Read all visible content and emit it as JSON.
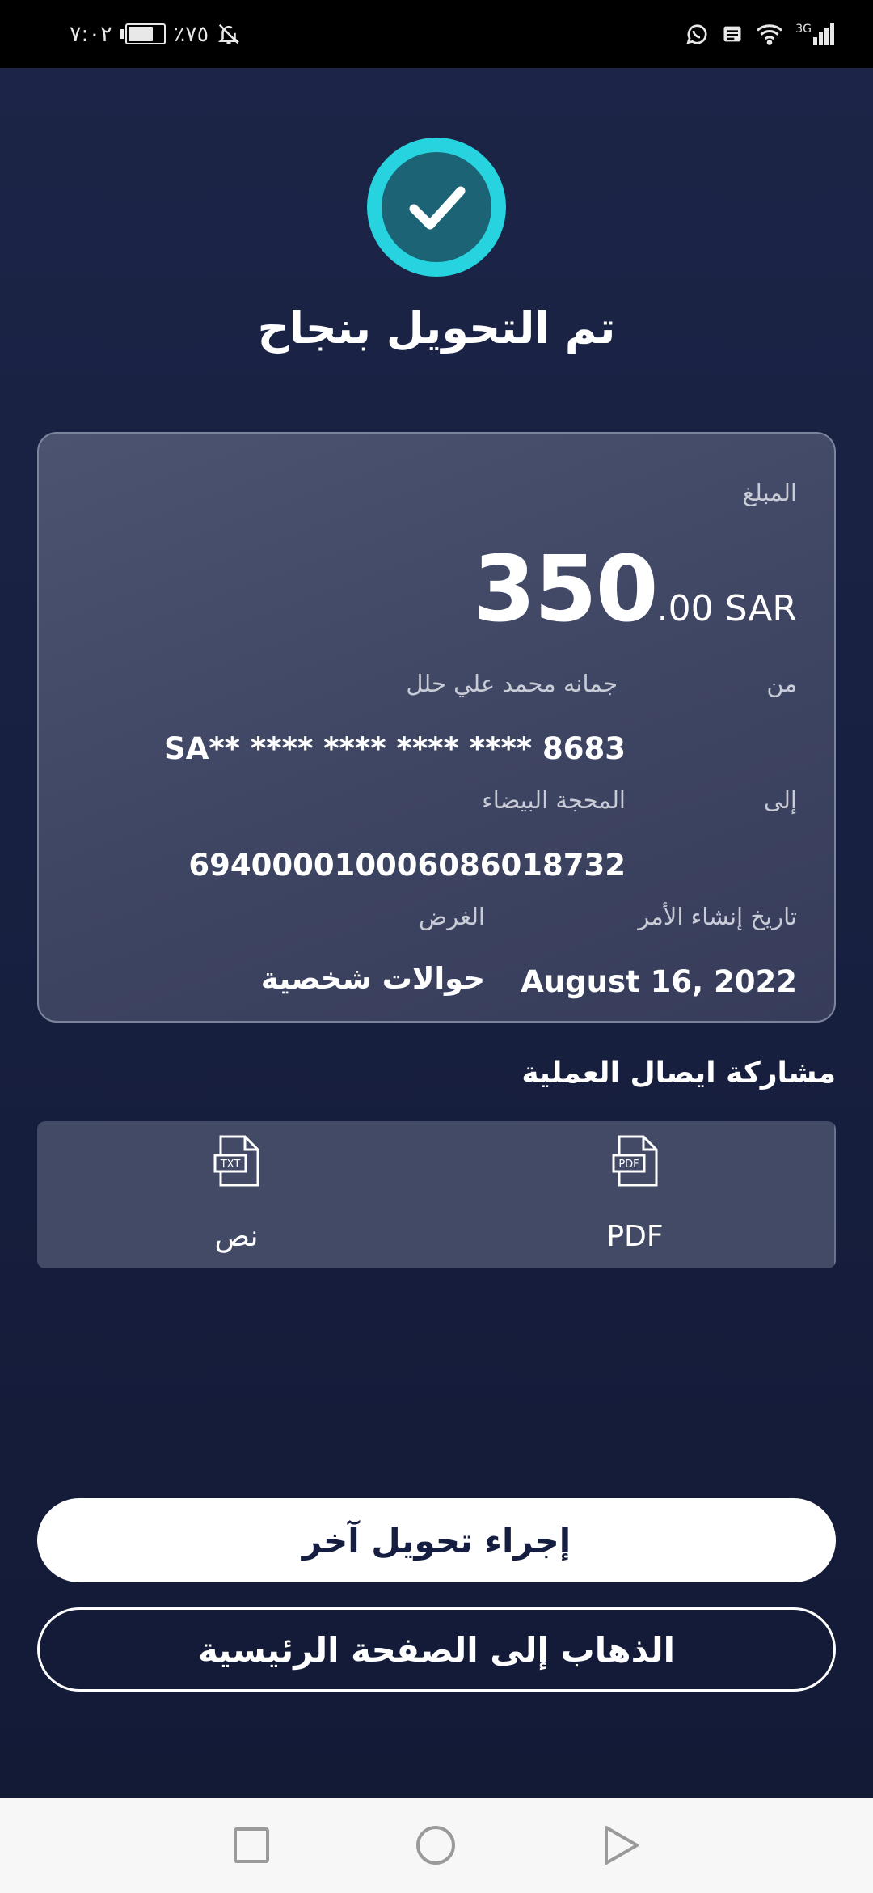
{
  "status_bar": {
    "time": "٧:٠٢",
    "battery_text": "٪٧٥",
    "battery_level": 0.75,
    "network": "3G"
  },
  "header": {
    "title": "تم التحويل بنجاح"
  },
  "card": {
    "amount_label": "المبلغ",
    "amount_main": "350",
    "amount_decimal": ".00 SAR",
    "from_label": "من",
    "from_name": "جمانه محمد علي حلل",
    "from_account": "SA** **** **** **** **** 8683",
    "to_label": "إلى",
    "to_name": "المحجة البيضاء",
    "to_account": "69400001000608601873​2",
    "date_label": "تاريخ إنشاء الأمر",
    "date_value": "August 16, 2022",
    "purpose_label": "الغرض",
    "purpose_value": "حوالات شخصية"
  },
  "share": {
    "title": "مشاركة ايصال العملية",
    "pdf_label": "PDF",
    "pdf_icon_text": "PDF",
    "text_label": "نص",
    "text_icon_text": "TXT"
  },
  "actions": {
    "another_transfer": "إجراء تحويل آخر",
    "go_home": "الذهاب إلى الصفحة الرئيسية"
  },
  "colors": {
    "background": "#171e3d",
    "accent": "#26d3de",
    "check_inner": "#1b6375"
  }
}
